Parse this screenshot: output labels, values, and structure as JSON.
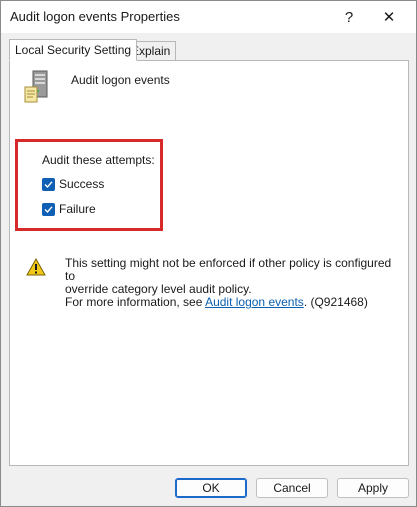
{
  "window": {
    "title": "Audit logon events Properties",
    "help_glyph": "?",
    "close_glyph": "✕"
  },
  "tabs": [
    {
      "label": "Local Security Setting",
      "active": true
    },
    {
      "label": "Explain",
      "active": false
    }
  ],
  "policy": {
    "icon": "server-icon",
    "name": "Audit logon events"
  },
  "audit": {
    "group_label": "Audit these attempts:",
    "options": [
      {
        "label": "Success",
        "checked": true
      },
      {
        "label": "Failure",
        "checked": true
      }
    ],
    "highlight_color": "#d62a2a"
  },
  "info": {
    "icon": "warning-icon",
    "line1": "This setting might not be enforced if other policy is configured to",
    "line2": "override category level audit policy.",
    "line3_prefix": "For more information, see ",
    "link_text": "Audit logon events",
    "line3_suffix": ". (Q921468)"
  },
  "buttons": {
    "ok": "OK",
    "cancel": "Cancel",
    "apply": "Apply"
  },
  "colors": {
    "accent": "#0f5fb4",
    "link": "#0a5fb0"
  }
}
